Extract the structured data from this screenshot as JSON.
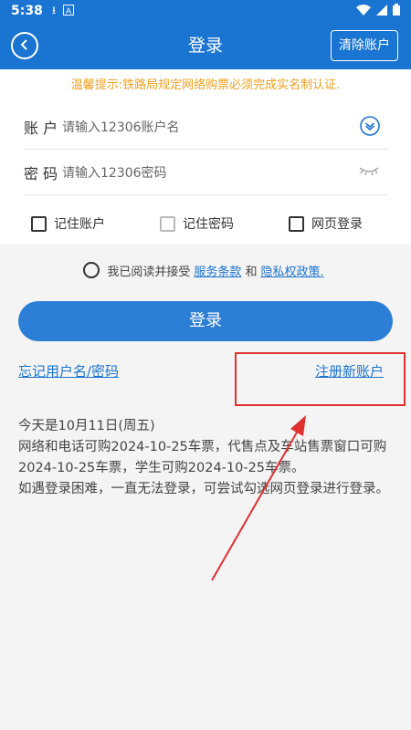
{
  "status_bar": {
    "time": "5:38",
    "icons": [
      "download-icon",
      "letter-a-icon",
      "wifi-icon",
      "signal-icon",
      "battery-icon"
    ]
  },
  "app_bar": {
    "title": "登录",
    "clear_label": "清除账户"
  },
  "notice": "温馨提示:铁路局规定网络购票必须完成实名制认证.",
  "form": {
    "account_label": "账 户",
    "account_placeholder": "请输入12306账户名",
    "password_label": "密 码",
    "password_placeholder": "请输入12306密码",
    "remember_account": "记住账户",
    "remember_password": "记住密码",
    "web_login": "网页登录"
  },
  "agreement": {
    "prefix": "我已阅读并接受",
    "terms": "服务条款",
    "and": "和",
    "privacy": "隐私权政策."
  },
  "login_label": "登录",
  "forgot_label": "忘记用户名/密码",
  "register_label": "注册新账户",
  "info": {
    "line1": "今天是10月11日(周五)",
    "line2": "网络和电话可购2024-10-25车票，代售点及车站售票窗口可购2024-10-25车票，学生可购2024-10-25车票。",
    "line3": "如遇登录困难，一直无法登录，可尝试勾选网页登录进行登录。"
  },
  "colors": {
    "primary": "#1a74d1",
    "notice": "#f0a020",
    "highlight": "#e03030"
  }
}
